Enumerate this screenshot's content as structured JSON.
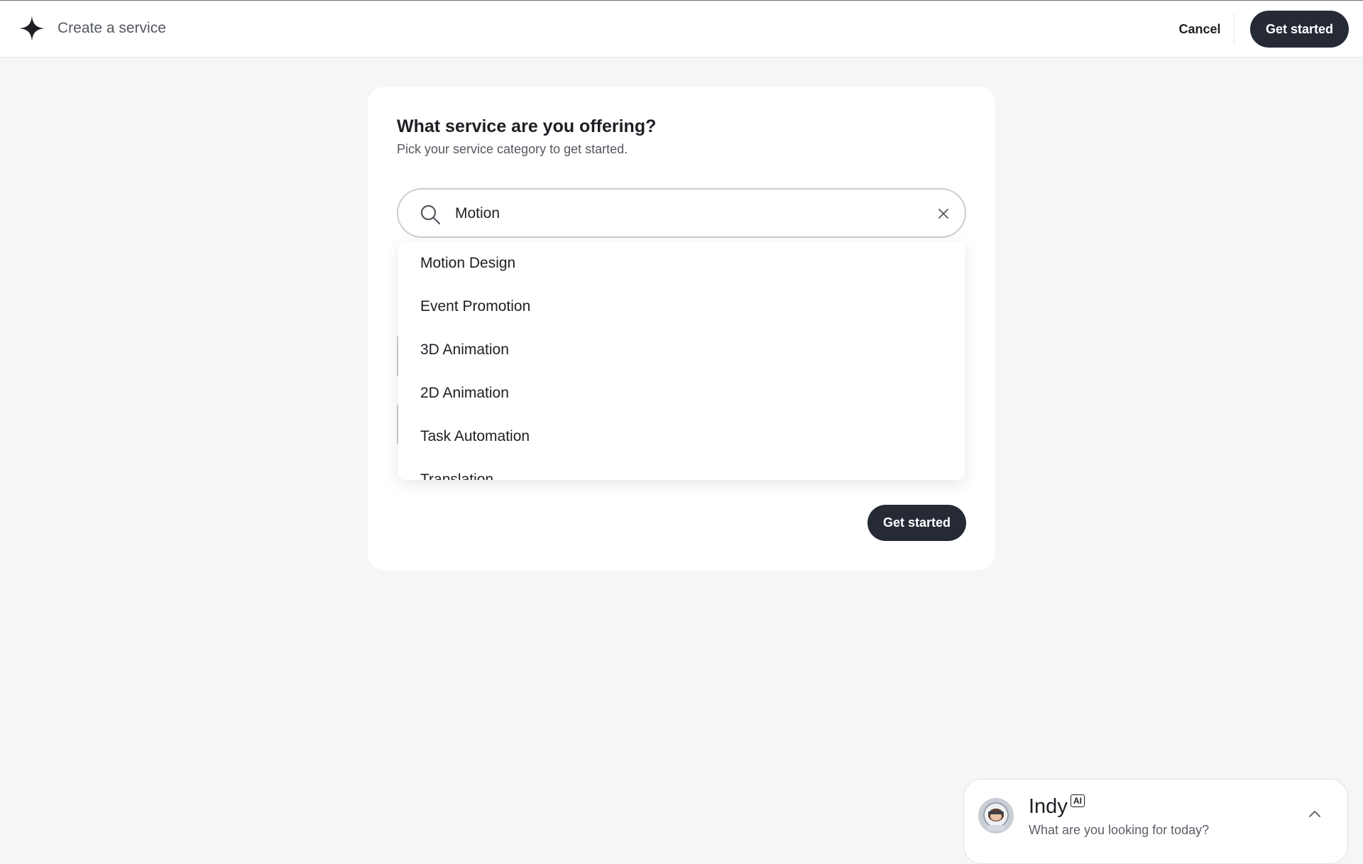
{
  "header": {
    "app_title": "Create a service",
    "cancel_label": "Cancel",
    "get_started_label": "Get started",
    "logo_icon": "sparkle-star-icon"
  },
  "card": {
    "title": "What service are you offering?",
    "subtitle": "Pick your service category to get started.",
    "search": {
      "value": "Motion",
      "icon": "search-icon",
      "clear_icon": "close-icon"
    },
    "suggestions": [
      "Motion Design",
      "Event Promotion",
      "3D Animation",
      "2D Animation",
      "Task Automation",
      "Translation"
    ],
    "get_started_label": "Get started"
  },
  "chat": {
    "name": "Indy",
    "badge": "AI",
    "prompt": "What are you looking for today?",
    "expand_icon": "chevron-up-icon"
  },
  "colors": {
    "background": "#f4f6f8",
    "primary_button": "#252a35",
    "text": "#1d1f24",
    "muted_text": "#54585f"
  }
}
